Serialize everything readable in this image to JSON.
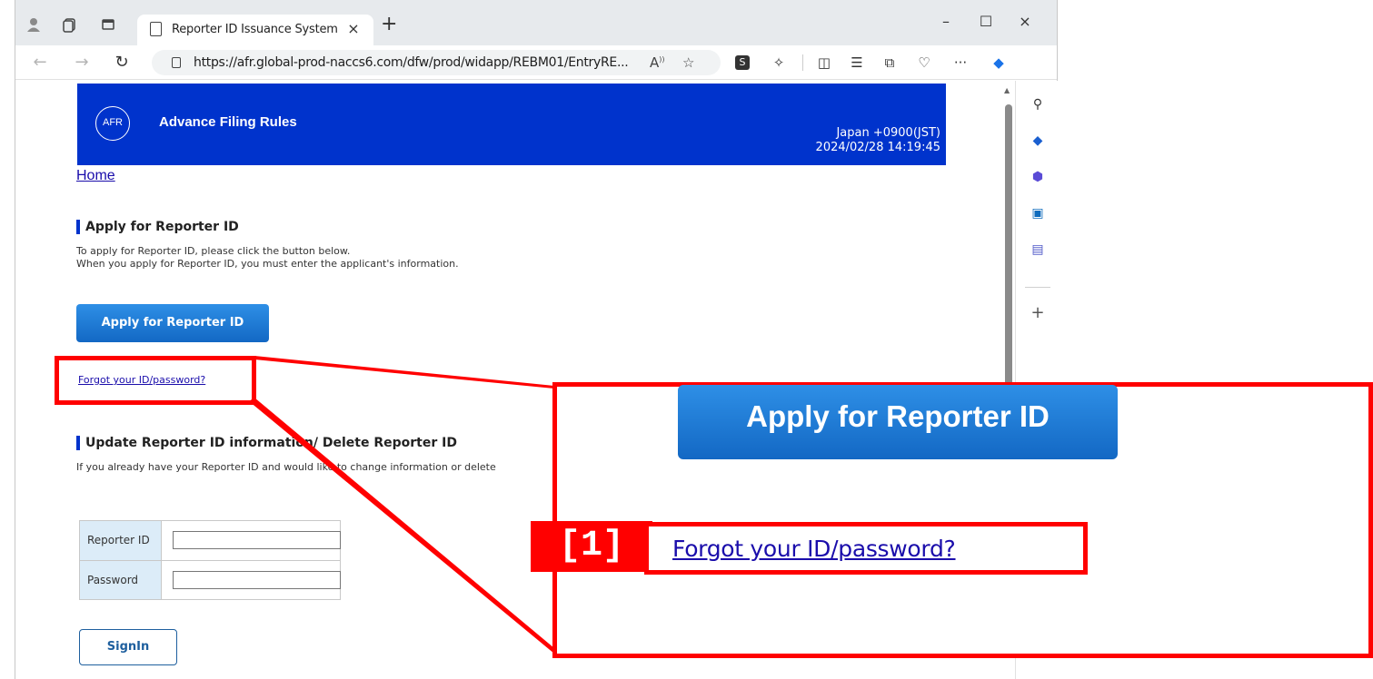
{
  "browser": {
    "tab_title": "Reporter ID Issuance System",
    "tab_close": "×",
    "new_tab": "+",
    "url": "https://afr.global-prod-naccs6.com/dfw/prod/widapp/REBM01/EntryRE...",
    "window_minimize": "–",
    "window_restore": "☐",
    "window_close": "×",
    "more_menu": "···"
  },
  "page": {
    "logo_text": "AFR",
    "header_title": "Advance Filing Rules",
    "timezone": "Japan +0900(JST)",
    "datetime": "2024/02/28 14:19:45",
    "home_link": "Home",
    "apply_section": {
      "title": "Apply for Reporter ID",
      "line1": "To apply for Reporter ID, please click the button below.",
      "line2": "When you apply for Reporter ID, you must enter the applicant's information.",
      "button": "Apply for Reporter ID"
    },
    "forgot_link": "Forgot your ID/password?",
    "update_section": {
      "title": "Update Reporter ID information/ Delete Reporter ID",
      "line1": "If you already have your Reporter ID and would like to change information or delete"
    },
    "signin": {
      "reporter_id_label": "Reporter ID",
      "reporter_id_value": "",
      "password_label": "Password",
      "password_value": "",
      "button": "SignIn"
    }
  },
  "annotation": {
    "zoom_button": "Apply for Reporter ID",
    "step_label": "[1]",
    "zoom_link": "Forgot your ID/password?",
    "highlight_color": "#ff0000"
  },
  "colors": {
    "header_blue": "#0033cc",
    "button_blue": "#1368c4",
    "link_blue": "#1a0dab"
  }
}
